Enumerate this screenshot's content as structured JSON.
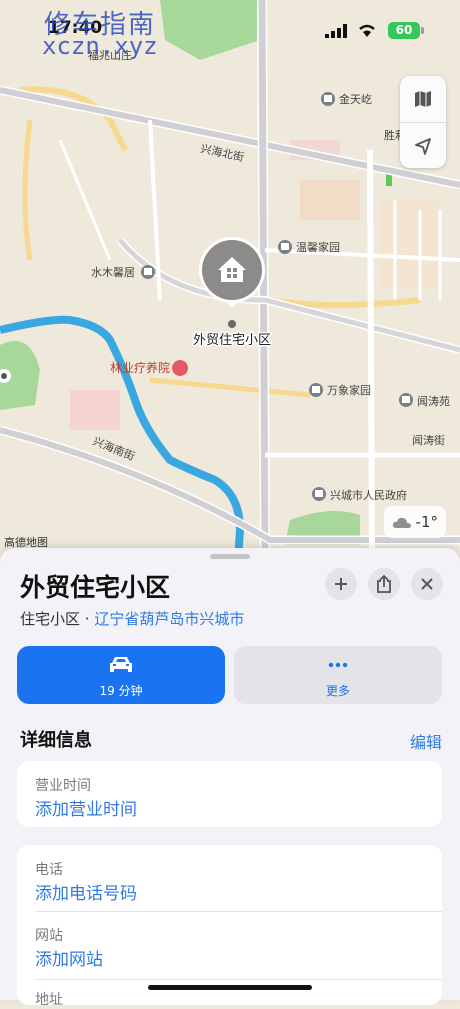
{
  "status_bar": {
    "time": "17:40",
    "battery": "60"
  },
  "watermark": {
    "line1": "修车指南",
    "line2": "xczn.xyz"
  },
  "map": {
    "pois": [
      "金天屹",
      "胜利",
      "温馨家园",
      "水木馨居",
      "万象家园",
      "闻涛苑",
      "兴城市人民政府",
      "林业疗养院",
      "福兆山庄"
    ],
    "streets": [
      "兴海北街",
      "兴海南街",
      "闻涛街"
    ],
    "pin_label": "外贸住宅小区",
    "weather": "-1°",
    "attribution": "高德地图"
  },
  "place": {
    "title": "外贸住宅小区",
    "category": "住宅小区",
    "separator": "·",
    "location": "辽宁省葫芦岛市兴城市"
  },
  "actions": {
    "drive": "19 分钟",
    "more": "更多"
  },
  "details": {
    "heading": "详细信息",
    "edit": "编辑",
    "hours_label": "营业时间",
    "hours_value": "添加营业时间",
    "phone_label": "电话",
    "phone_value": "添加电话号码",
    "website_label": "网站",
    "website_value": "添加网站",
    "address_label": "地址"
  },
  "colors": {
    "accent": "#1a73f0",
    "link": "#2f7ae5",
    "map_bg": "#efe9dc",
    "water": "#3aa8e0",
    "park": "#a8d79a"
  }
}
